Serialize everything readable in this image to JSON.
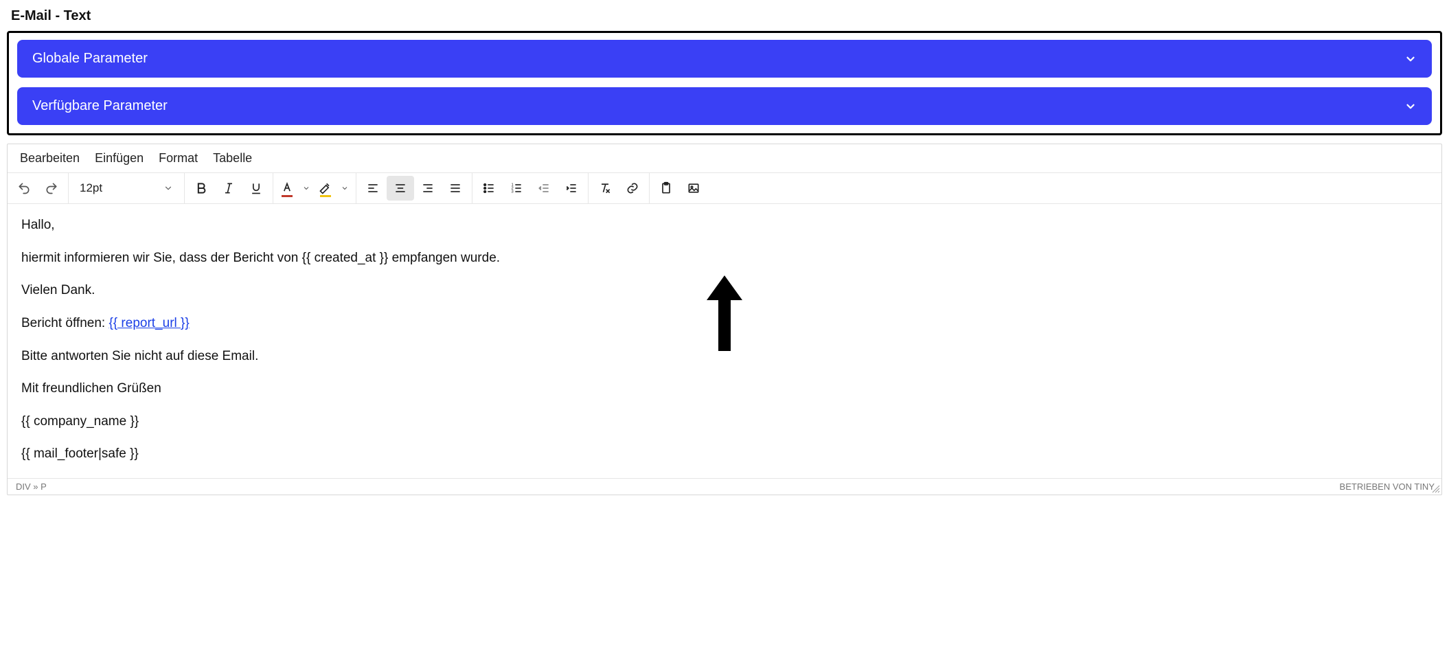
{
  "section_title": "E-Mail - Text",
  "accordions": {
    "global": "Globale Parameter",
    "available": "Verfügbare Parameter"
  },
  "menubar": {
    "edit": "Bearbeiten",
    "insert": "Einfügen",
    "format": "Format",
    "table": "Tabelle"
  },
  "toolbar": {
    "font_size": "12pt"
  },
  "content": {
    "p1": "Hallo,",
    "p2": "hiermit informieren wir Sie, dass der Bericht von {{ created_at }} empfangen wurde.",
    "p3": "Vielen Dank.",
    "p4_prefix": "Bericht öffnen: ",
    "p4_link": "{{ report_url }}",
    "p5": "Bitte antworten Sie nicht auf diese Email.",
    "p6": "Mit freundlichen Grüßen",
    "p7": "{{ company_name }}",
    "p8": "{{ mail_footer|safe }}"
  },
  "statusbar": {
    "path": "DIV » P",
    "branding": "BETRIEBEN VON TINY"
  }
}
